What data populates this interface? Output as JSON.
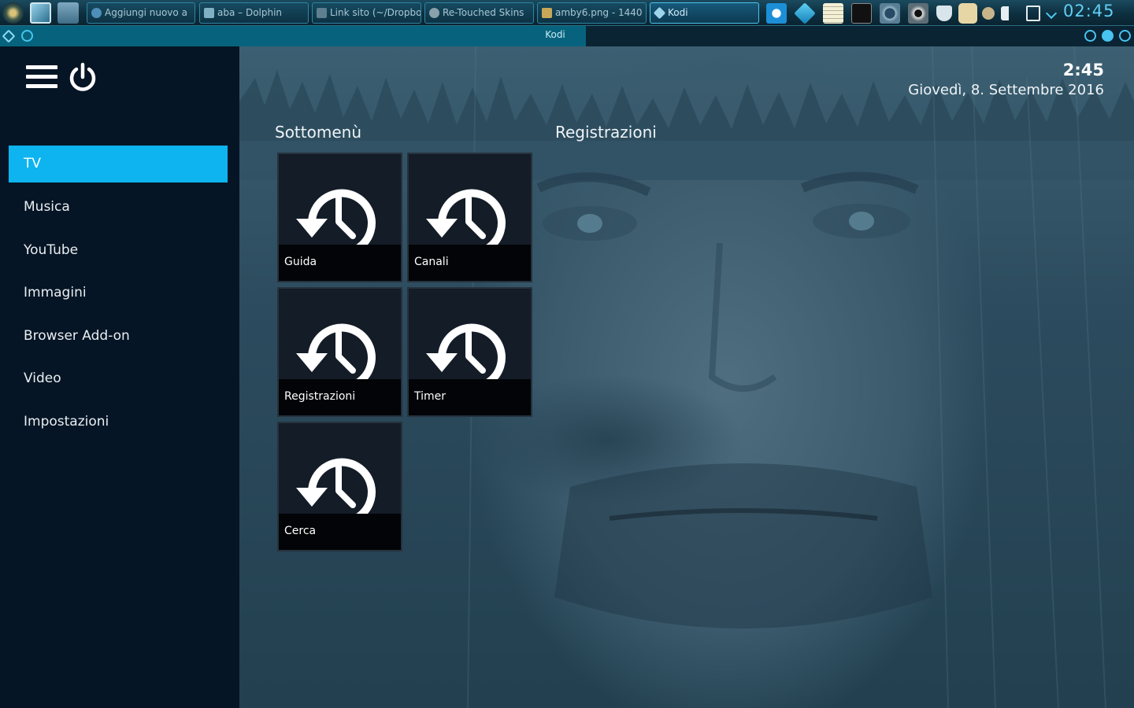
{
  "taskbar": {
    "tasks": [
      {
        "label": "Aggiungi nuovo a"
      },
      {
        "label": "aba – Dolphin"
      },
      {
        "label": "Link sito (~/Dropbo"
      },
      {
        "label": "Re-Touched Skins"
      },
      {
        "label": "amby6.png - 1440"
      },
      {
        "label": "Kodi"
      }
    ],
    "clock": "02:45"
  },
  "window": {
    "title": "Kodi"
  },
  "sidebar": {
    "items": [
      {
        "label": "TV",
        "selected": true
      },
      {
        "label": "Musica"
      },
      {
        "label": "YouTube"
      },
      {
        "label": "Immagini"
      },
      {
        "label": "Browser Add-on"
      },
      {
        "label": "Video"
      },
      {
        "label": "Impostazioni"
      }
    ]
  },
  "header": {
    "time": "2:45",
    "date": "Giovedì, 8. Settembre 2016"
  },
  "main": {
    "submenu_title": "Sottomenù",
    "content_title": "Registrazioni",
    "tiles": [
      {
        "label": "Guida",
        "icon": "history-clock-icon"
      },
      {
        "label": "Canali",
        "icon": "history-clock-icon"
      },
      {
        "label": "Registrazioni",
        "icon": "history-clock-icon"
      },
      {
        "label": "Timer",
        "icon": "history-clock-icon"
      },
      {
        "label": "Cerca",
        "icon": "history-clock-icon"
      }
    ]
  },
  "colors": {
    "accent": "#0db4ef",
    "sidebar_bg": "#061525",
    "taskbar_clock": "#5fcff5"
  }
}
